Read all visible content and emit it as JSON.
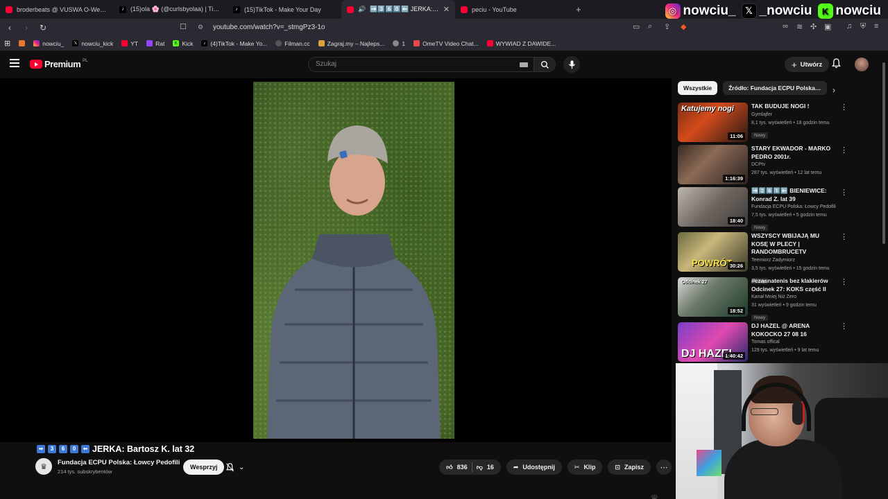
{
  "browser": {
    "tabs": [
      {
        "title": "broderbeats @ VUSWA O-Week 2024",
        "favicon": "youtube"
      },
      {
        "title": "(15)ola 🌸 (@curlsbyolaa) | TikTok",
        "favicon": "tiktok"
      },
      {
        "title": "(15)TikTok - Make Your Day",
        "favicon": "tiktok"
      },
      {
        "title": "➡️3️⃣6️⃣0️⃣⬅️ JERKA: Bartosz K. lat 32",
        "favicon": "youtube",
        "active": true
      },
      {
        "title": "peciu - YouTube",
        "favicon": "youtube"
      }
    ],
    "new_tab": "+",
    "url": "youtube.com/watch?v=_stmgPz3-1o",
    "bookmarks": [
      {
        "label": "",
        "icon": "rss"
      },
      {
        "label": "nowciu_",
        "icon": "instagram"
      },
      {
        "label": "nowciu_kick",
        "icon": "x"
      },
      {
        "label": "YT",
        "icon": "youtube"
      },
      {
        "label": "Rat",
        "icon": "twitch"
      },
      {
        "label": "Kick",
        "icon": "kick"
      },
      {
        "label": "(4)TikTok - Make Yo...",
        "icon": "tiktok"
      },
      {
        "label": "Filman.cc",
        "icon": "filman"
      },
      {
        "label": "Zagraj.my – Najleps...",
        "icon": "zagraj"
      },
      {
        "label": "1",
        "icon": "globe"
      },
      {
        "label": "OmeTV Video Chat...",
        "icon": "ometv"
      },
      {
        "label": "WYWIAD Z DAWIDE...",
        "icon": "youtube"
      }
    ]
  },
  "socials": [
    {
      "handle": "nowciu_",
      "icon": "instagram"
    },
    {
      "handle": "_nowciu",
      "icon": "x"
    },
    {
      "handle": "nowciu",
      "icon": "kick"
    }
  ],
  "masthead": {
    "logo": "Premium",
    "country": "PL",
    "search_placeholder": "Szukaj",
    "create_label": "Utwórz"
  },
  "video": {
    "title_emojis": [
      "➡",
      "3",
      "6",
      "0",
      "⬅"
    ],
    "title": "JERKA: Bartosz K. lat 32",
    "channel": "Fundacja ECPU Polska: Łowcy Pedofili",
    "subscribers": "214 tys. subskrybentów",
    "support_label": "Wesprzyj",
    "likes": "836",
    "dislikes": "16",
    "share_label": "Udostępnij",
    "clip_label": "Klip",
    "save_label": "Zapisz"
  },
  "sidebar": {
    "chips": [
      {
        "label": "Wszystkie",
        "active": true
      },
      {
        "label": "Źródło: Fundacja ECPU Polska: Łowcy Pedofili",
        "active": false
      }
    ],
    "recommendations": [
      {
        "title": "TAK BUDUJE NOGI !",
        "channel": "Gymlajfer",
        "views": "8,1 tys. wyświetleń",
        "age": "18 godzin temu",
        "badge": "Nowy",
        "duration": "11:06",
        "caption": "Katujemy nogi"
      },
      {
        "title": "STARY EKWADOR -  MARKO PEDRO 2001r.",
        "channel": "DCPtv",
        "views": "287 tys. wyświetleń",
        "age": "12 lat temu",
        "badge": "",
        "duration": "1:16:39",
        "caption": ""
      },
      {
        "title": "➡️2️⃣6️⃣1️⃣⬅️ BIENIEWICE: Konrad Z. lat 39",
        "channel": "Fundacja ECPU Polska: Łowcy Pedofili",
        "views": "7,5 tys. wyświetleń",
        "age": "5 godzin temu",
        "badge": "Nowy",
        "duration": "18:40",
        "caption": ""
      },
      {
        "title": "WSZYSCY WBIJAJĄ MU KOSĘ W PLECY | RANDOMBRUCETV",
        "channel": "Teemiorz Zadymiorz",
        "views": "3,5 tys. wyświetleń",
        "age": "15 godzin temu",
        "badge": "Nowy",
        "duration": "30:26",
        "caption": "POWRÓT"
      },
      {
        "title": "#czasnatenis bez klakierów Odcinek 27: KOKS część II",
        "channel": "Kanał Mniej Niż Zero",
        "views": "31 wyświetleń",
        "age": "9 godzin temu",
        "badge": "Nowy",
        "duration": "18:52",
        "caption": "Odcinek 27"
      },
      {
        "title": "DJ HAZEL @ ARENA KOKOCKO 27 08 16",
        "channel": "Tomas offical",
        "views": "129 tys. wyświetleń",
        "age": "9 lat temu",
        "badge": "",
        "duration": "1:40:42",
        "caption": "DJ HAZEL"
      }
    ]
  },
  "colors": {
    "yt_red": "#ff0033",
    "background": "#0f0f0f",
    "chip_bg": "#272727",
    "kick_green": "#53fc18"
  }
}
